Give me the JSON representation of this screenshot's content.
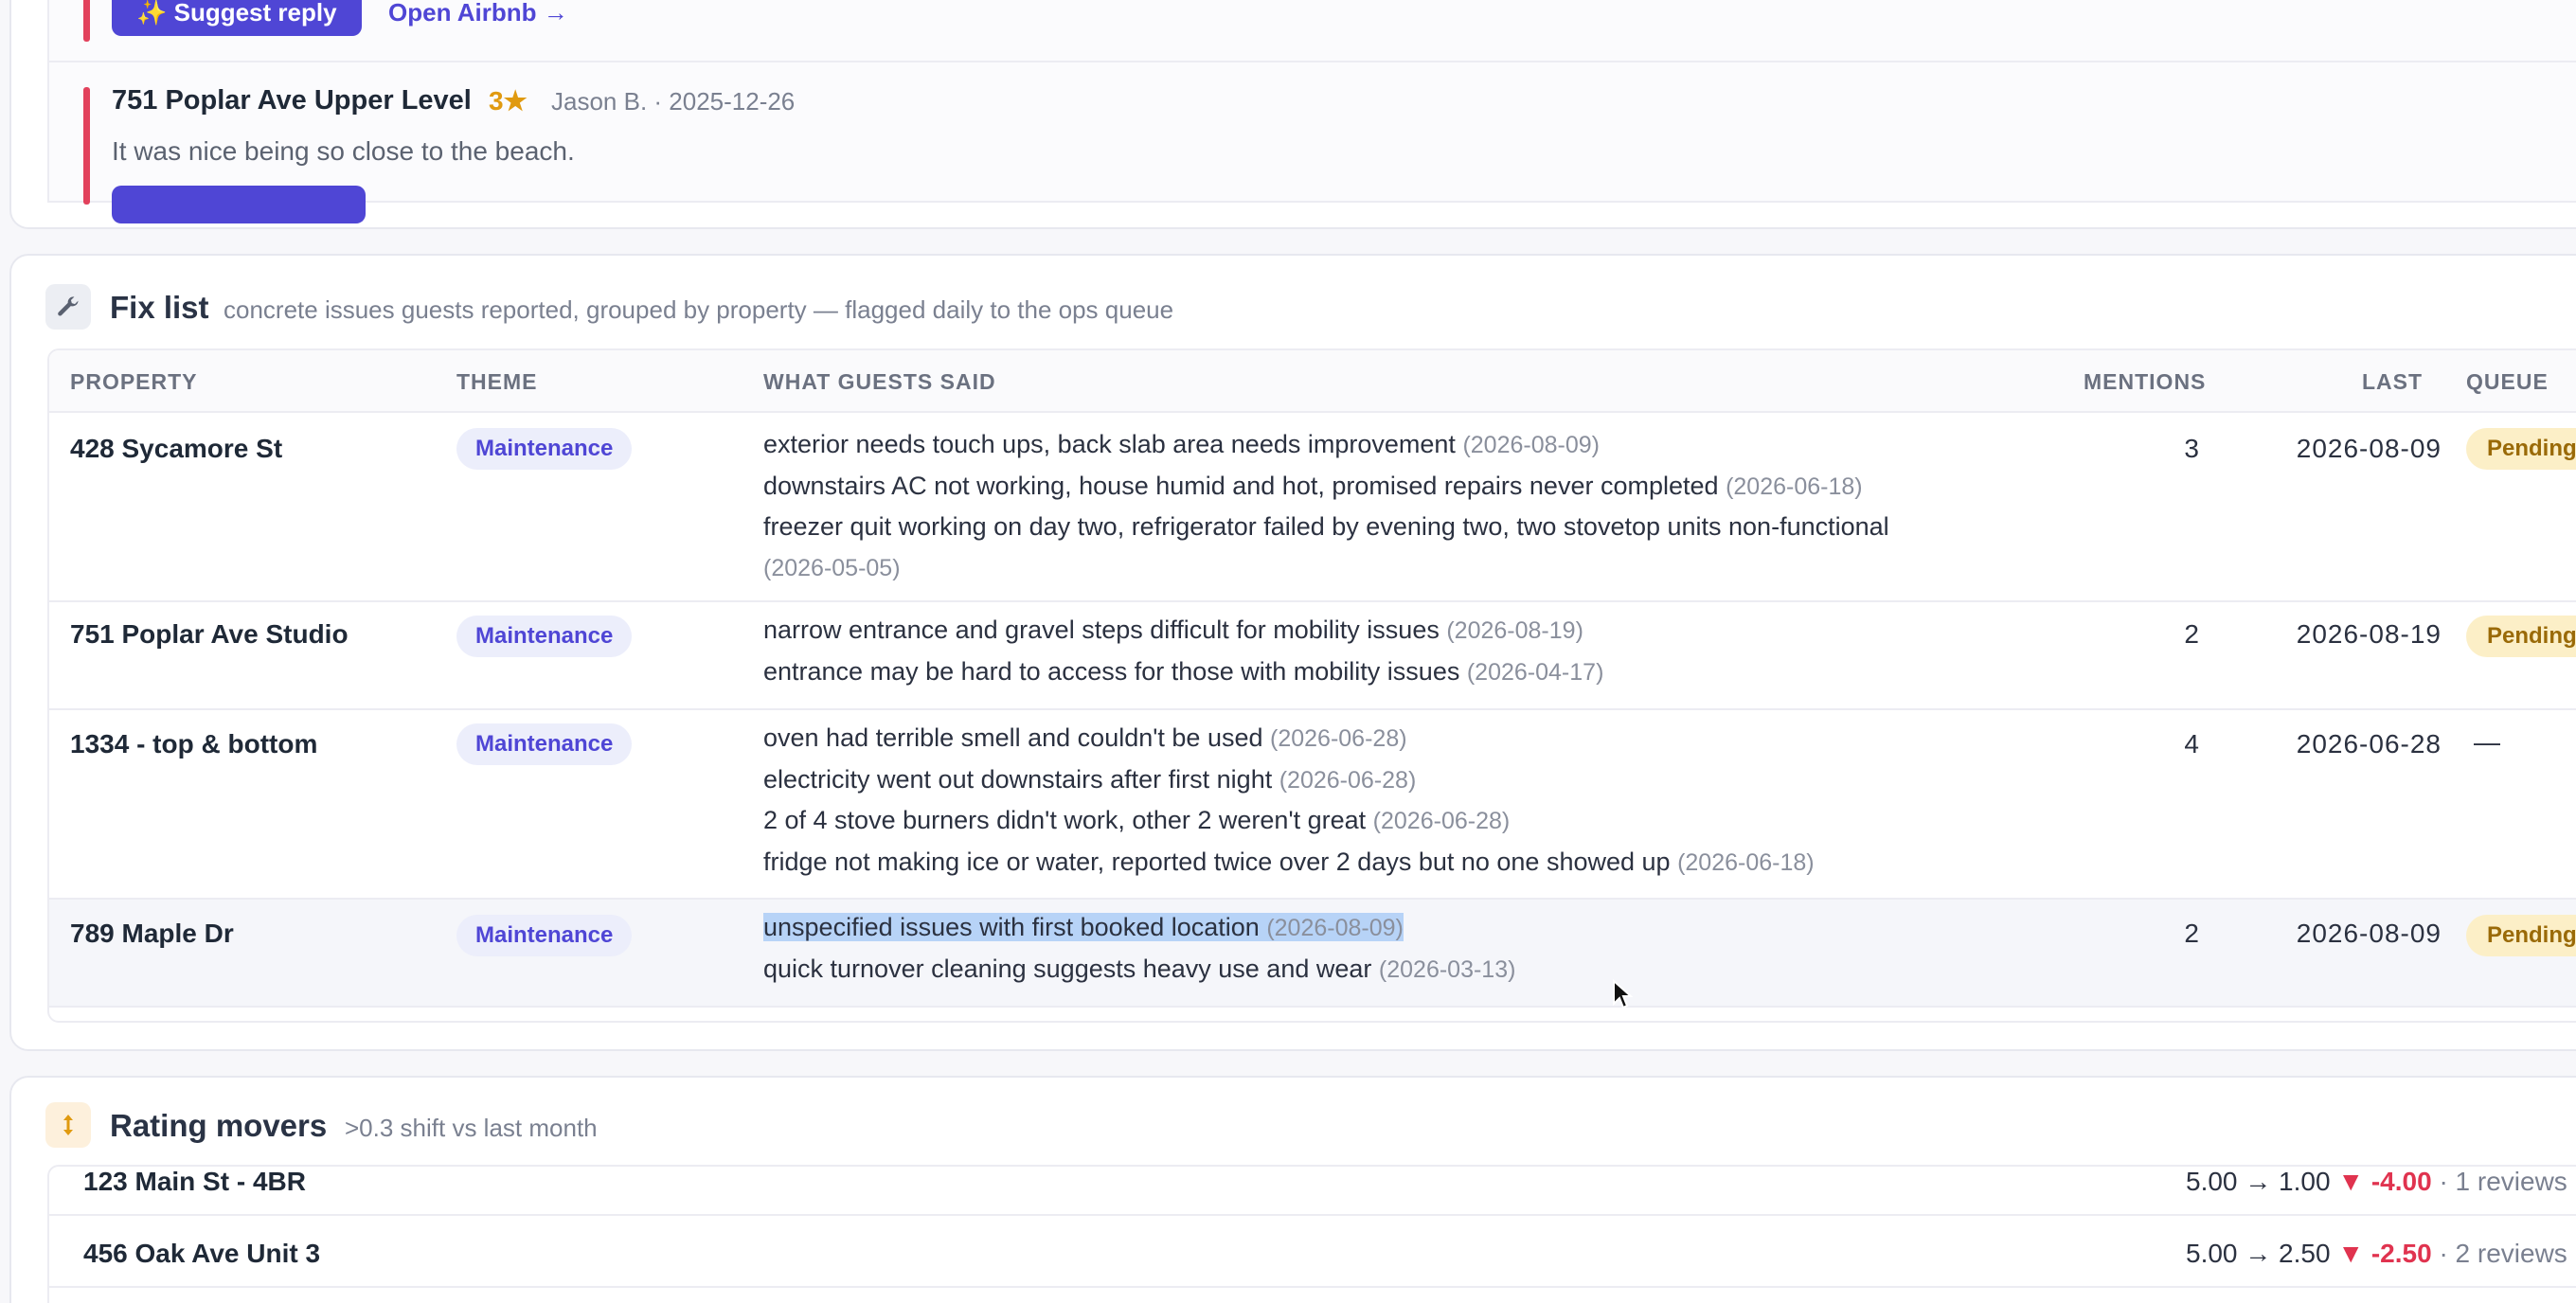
{
  "reviews": {
    "first_actions": {
      "suggest_label": "✨ Suggest reply",
      "open_label": "Open Airbnb →"
    },
    "second": {
      "property": "751 Poplar Ave Upper Level",
      "rating": "3★",
      "meta": "Jason B. · 2025-12-26",
      "text": "It was nice being so close to the beach."
    }
  },
  "fix_list": {
    "icon": "wrench-icon",
    "title": "Fix list",
    "subtitle": "concrete issues guests reported, grouped by property — flagged daily to the ops queue",
    "columns": {
      "property": "PROPERTY",
      "theme": "THEME",
      "said": "WHAT GUESTS SAID",
      "mentions": "MENTIONS",
      "last": "LAST",
      "queue": "QUEUE"
    },
    "rows": [
      {
        "property": "428 Sycamore St",
        "theme": "Maintenance",
        "mentions": "3",
        "last": "2026-08-09",
        "queue": "Pending",
        "quotes": [
          {
            "text": "exterior needs touch ups, back slab area needs improvement",
            "date": "(2026-08-09)"
          },
          {
            "text": "downstairs AC not working, house humid and hot, promised repairs never completed",
            "date": "(2026-06-18)"
          },
          {
            "text": "freezer quit working on day two, refrigerator failed by evening two, two stovetop units non-functional",
            "date": "(2026-05-05)"
          }
        ]
      },
      {
        "property": "751 Poplar Ave Studio",
        "theme": "Maintenance",
        "mentions": "2",
        "last": "2026-08-19",
        "queue": "Pending",
        "quotes": [
          {
            "text": "narrow entrance and gravel steps difficult for mobility issues",
            "date": "(2026-08-19)"
          },
          {
            "text": "entrance may be hard to access for those with mobility issues",
            "date": "(2026-04-17)"
          }
        ]
      },
      {
        "property": "1334 - top & bottom",
        "theme": "Maintenance",
        "mentions": "4",
        "last": "2026-06-28",
        "queue": "—",
        "quotes": [
          {
            "text": "oven had terrible smell and couldn't be used",
            "date": "(2026-06-28)"
          },
          {
            "text": "electricity went out downstairs after first night",
            "date": "(2026-06-28)"
          },
          {
            "text": "2 of 4 stove burners didn't work, other 2 weren't great",
            "date": "(2026-06-28)"
          },
          {
            "text": "fridge not making ice or water, reported twice over 2 days but no one showed up",
            "date": "(2026-06-18)"
          }
        ]
      },
      {
        "property": "789 Maple Dr",
        "theme": "Maintenance",
        "mentions": "2",
        "last": "2026-08-09",
        "queue": "Pending",
        "quotes": [
          {
            "text": "unspecified issues with first booked location",
            "date": "(2026-08-09)"
          },
          {
            "text": "quick turnover cleaning suggests heavy use and wear",
            "date": "(2026-03-13)"
          }
        ]
      }
    ]
  },
  "movers": {
    "icon": "up-down-arrows-icon",
    "title": "Rating movers",
    "subtitle": ">0.3 shift vs last month",
    "rows": [
      {
        "property": "123 Main St - 4BR",
        "change": "5.00 → 1.00",
        "delta": "▼ -4.00",
        "count": "· 1 reviews"
      },
      {
        "property": "456 Oak Ave Unit 3",
        "change": "5.00 → 2.50",
        "delta": "▼ -2.50",
        "count": "· 2 reviews"
      }
    ]
  },
  "colors": {
    "accent": "#4f46d5",
    "alert": "#e2415c",
    "pending_bg": "#fcefc7",
    "selection": "#b7d3f7"
  }
}
